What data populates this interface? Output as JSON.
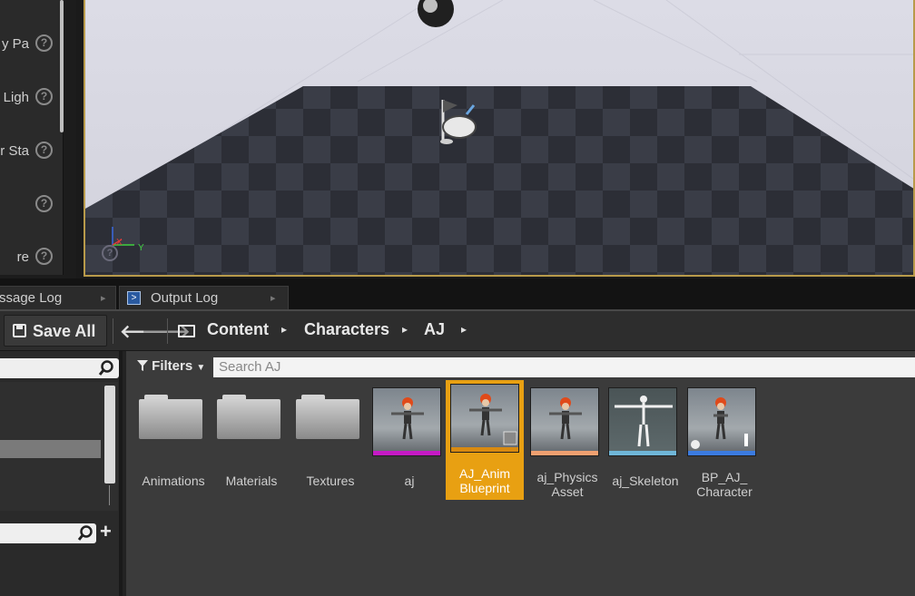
{
  "details": {
    "props": [
      {
        "label": "y Pa",
        "help": "?"
      },
      {
        "label": "Ligh",
        "help": "?"
      },
      {
        "label": "er Sta",
        "help": "?"
      },
      {
        "label": "",
        "help": "?"
      },
      {
        "label": "re",
        "help": "?"
      }
    ]
  },
  "viewport": {
    "axis_x": "X",
    "axis_y": "Y",
    "help": "?"
  },
  "tabs": [
    {
      "label": "ssage Log",
      "close": "▸"
    },
    {
      "label": "Output Log",
      "close": "▸"
    }
  ],
  "toolbar": {
    "save_all": "Save All",
    "back": "🡐",
    "forward": "🡒",
    "breadcrumb": [
      "Content",
      "Characters",
      "AJ"
    ],
    "crumb_arrow": "▸"
  },
  "sources": {
    "search_placeholder": "",
    "add": "+"
  },
  "assets": {
    "filters_label": "Filters",
    "search_placeholder": "Search AJ",
    "items": [
      {
        "kind": "folder",
        "name": "Animations"
      },
      {
        "kind": "folder",
        "name": "Materials"
      },
      {
        "kind": "folder",
        "name": "Textures"
      },
      {
        "kind": "asset",
        "name": "aj",
        "strip_color": "#c51ac5"
      },
      {
        "kind": "asset",
        "name": "AJ_Anim Blueprint",
        "strip_color": "#d88a10",
        "selected": true
      },
      {
        "kind": "asset",
        "name": "aj_Physics Asset",
        "strip_color": "#f0a070"
      },
      {
        "kind": "asset",
        "name": "aj_Skeleton",
        "strip_color": "#6fb6d8"
      },
      {
        "kind": "asset",
        "name": "BP_AJ_ Character",
        "strip_color": "#3b7be0"
      }
    ]
  },
  "colors": {
    "selection": "#e8a012",
    "viewport_border": "#b89a4a"
  }
}
